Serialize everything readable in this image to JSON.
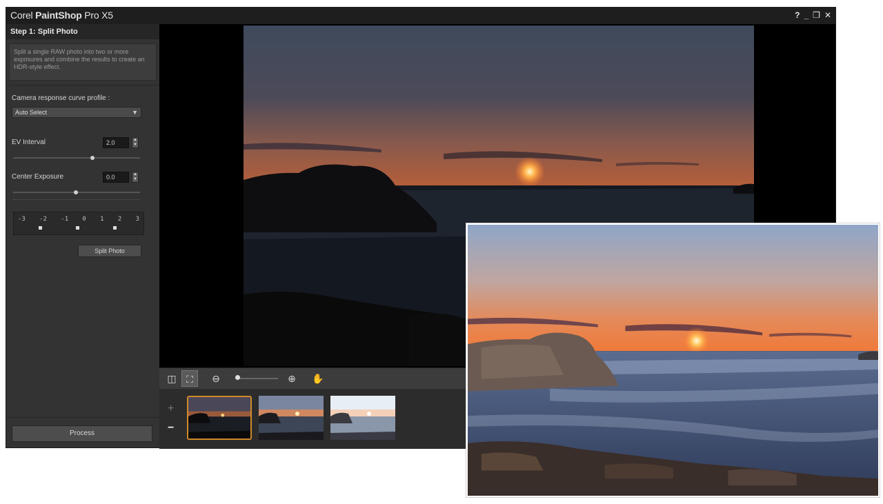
{
  "window": {
    "title_prefix": "Corel",
    "title_brand": "PaintShop",
    "title_suffix": "Pro X5",
    "controls": {
      "help": "?",
      "minimize": "_",
      "restore": "❐",
      "close": "✕"
    }
  },
  "panel": {
    "step_title": "Step 1: Split Photo",
    "description": "Split a single RAW photo into two or more exposures and combine the results to create an HDR-style effect.",
    "camera_label": "Camera response curve profile :",
    "camera_value": "Auto Select",
    "ev_interval_label": "EV Interval",
    "ev_interval_value": "2.0",
    "center_exposure_label": "Center Exposure",
    "center_exposure_value": "0.0",
    "ev_scale": [
      "-3",
      "-2",
      "-1",
      "0",
      "1",
      "2",
      "3"
    ],
    "split_button": "Split Photo",
    "process_button": "Process"
  },
  "toolbar": {
    "icons": [
      "fit-icon",
      "actual-size-icon",
      "zoom-out-icon",
      "zoom-in-icon",
      "pan-hand-icon"
    ]
  },
  "filmstrip": {
    "add": "+",
    "remove": "−",
    "thumbnails": [
      "underexposed",
      "normal",
      "overexposed"
    ],
    "selected_index": 0
  },
  "colors": {
    "accent": "#d08a2a",
    "panel_bg": "#333333",
    "titlebar_bg": "#1e1e1e"
  }
}
